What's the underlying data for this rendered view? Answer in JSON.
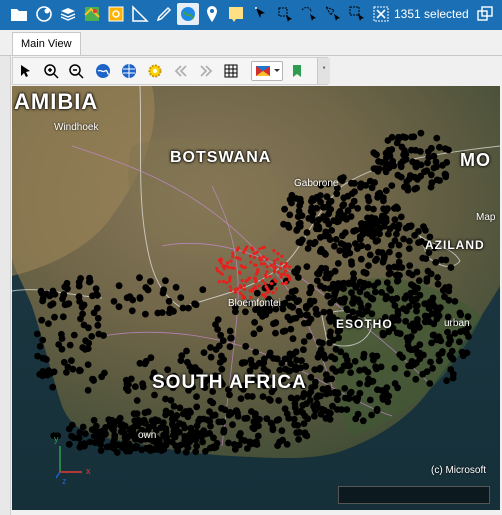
{
  "toolbar": {
    "icons": [
      "folder-icon",
      "globe-settings-icon",
      "layers-icon",
      "map-icon",
      "image-icon",
      "measure-icon",
      "draw-icon",
      "globe-icon",
      "pin-icon",
      "note-icon",
      "select-arrow-icon",
      "select-polygon-icon",
      "select-freehand-icon",
      "select-shape-icon",
      "select-rect-icon",
      "deselect-icon"
    ],
    "selection_count": "1351 selected",
    "restore_icon": "restore-window-icon"
  },
  "tabs": {
    "main_view": "Main View"
  },
  "map_toolbar": {
    "icons": [
      "pointer-icon",
      "zoom-in-icon",
      "zoom-out-icon",
      "globe-view-icon",
      "globe-full-icon",
      "settings-gear-icon",
      "previous-icon",
      "next-icon",
      "grid-icon",
      "basemap-icon",
      "bookmark-icon"
    ]
  },
  "map": {
    "labels": {
      "namibia": "AMIBIA",
      "botswana": "BOTSWANA",
      "south_africa": "SOUTH AFRICA",
      "lesotho": "ESOTHO",
      "swaziland": "AZILAND",
      "mozambique": "MO",
      "windhoek": "Windhoek",
      "gaborone": "Gaborone",
      "bloemfontein": "Bloemfontei",
      "durban": "urban",
      "maputo": "Map",
      "town": "own"
    },
    "copyright": "(c) Microsoft",
    "axis": {
      "x": "x",
      "y": "y",
      "z": "z"
    },
    "colors": {
      "points": "#000000",
      "highlight": "#e8201c"
    }
  }
}
